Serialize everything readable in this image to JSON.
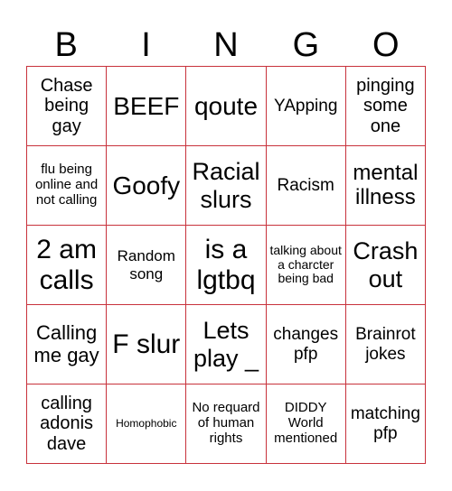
{
  "header": {
    "letters": [
      "B",
      "I",
      "N",
      "G",
      "O"
    ]
  },
  "colors": {
    "grid_border": "#c8323c",
    "text": "#000000",
    "background": "#ffffff"
  },
  "cells": [
    [
      "Chase being gay",
      "BEEF",
      "qoute",
      "YApping",
      "pinging some one"
    ],
    [
      "flu being online and not calling",
      "Goofy",
      "Racial slurs",
      "Racism",
      "mental illness"
    ],
    [
      "2 am calls",
      "Random song",
      "is a lgtbq",
      "talking about a charcter being bad",
      "Crash out"
    ],
    [
      "Calling me gay",
      "F slur",
      "Lets play _",
      "changes pfp",
      "Brainrot jokes"
    ],
    [
      "calling adonis dave",
      "Homophobic",
      "No requard of human rights",
      "DIDDY World mentioned",
      "matching pfp"
    ]
  ]
}
